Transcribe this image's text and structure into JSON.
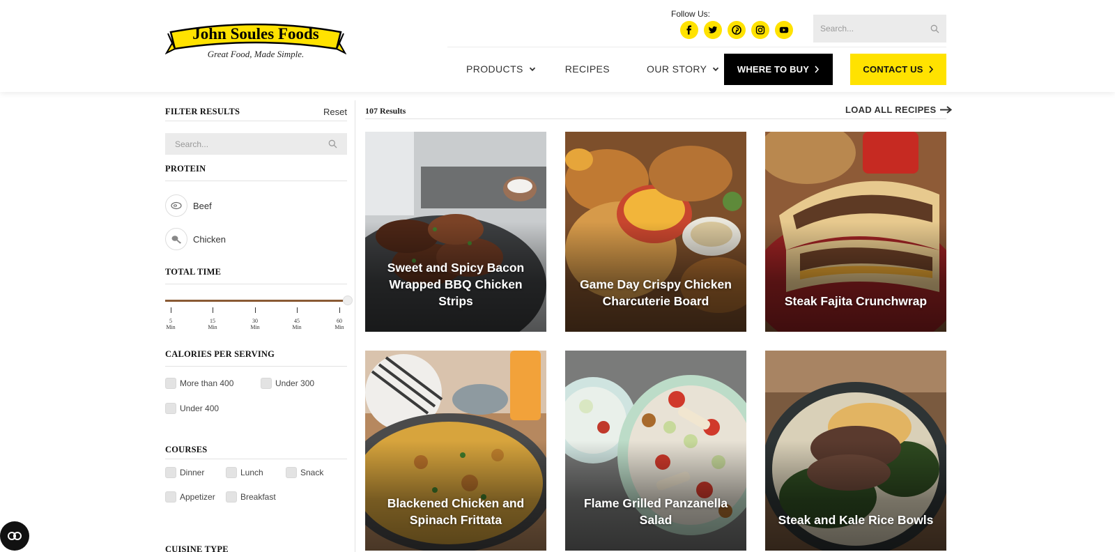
{
  "brand": {
    "name": "John Soules Foods",
    "tagline": "Great Food, Made Simple.",
    "yellow": "#ffe200",
    "black": "#000000"
  },
  "header": {
    "follow_label": "Follow Us:",
    "socials": [
      "facebook-icon",
      "twitter-icon",
      "pinterest-icon",
      "instagram-icon",
      "youtube-icon"
    ],
    "search_placeholder": "Search...",
    "nav": {
      "products": "PRODUCTS",
      "recipes": "RECIPES",
      "our_story": "OUR STORY"
    },
    "where_to_buy": "WHERE TO BUY",
    "contact_us": "CONTACT US"
  },
  "sidebar": {
    "filter_title": "FILTER RESULTS",
    "reset": "Reset",
    "search_placeholder": "Search...",
    "protein": {
      "title": "PROTEIN",
      "items": [
        "Beef",
        "Chicken"
      ]
    },
    "total_time": {
      "title": "TOTAL TIME",
      "ticks": [
        {
          "value": "5",
          "unit": "Min"
        },
        {
          "value": "15",
          "unit": "Min"
        },
        {
          "value": "30",
          "unit": "Min"
        },
        {
          "value": "45",
          "unit": "Min"
        },
        {
          "value": "60",
          "unit": "Min"
        }
      ],
      "selected_max_fraction": 1.0
    },
    "calories": {
      "title": "CALORIES PER SERVING",
      "options": [
        "More than 400",
        "Under 300",
        "Under 400"
      ]
    },
    "courses": {
      "title": "COURSES",
      "options": [
        "Dinner",
        "Lunch",
        "Snack",
        "Appetizer",
        "Breakfast"
      ]
    },
    "cuisine": {
      "title": "CUISINE TYPE"
    }
  },
  "results": {
    "count": "107 Results",
    "load_all": "LOAD ALL RECIPES",
    "cards": [
      {
        "title": "Sweet and Spicy Bacon Wrapped BBQ Chicken Strips"
      },
      {
        "title": "Game Day Crispy Chicken Charcuterie Board"
      },
      {
        "title": "Steak Fajita Crunchwrap"
      },
      {
        "title": "Blackened Chicken and Spinach Frittata"
      },
      {
        "title": "Flame Grilled Panzanella Salad"
      },
      {
        "title": "Steak and Kale Rice Bowls"
      }
    ]
  }
}
